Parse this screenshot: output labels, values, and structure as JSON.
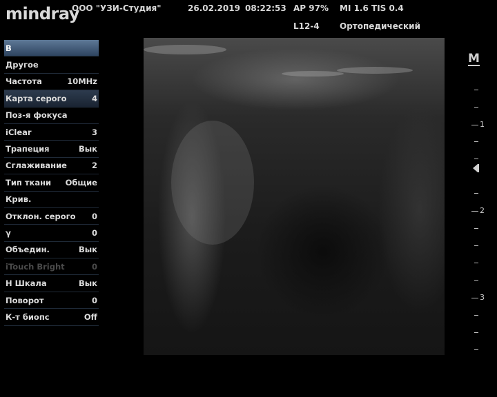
{
  "header": {
    "logo": "mindray",
    "clinic": "ООО \"УЗИ-Студия\"",
    "date": "26.02.2019",
    "time": "08:22:53",
    "ap": "AP  97%",
    "mi_tis": "MI 1.6  TIS 0.4",
    "probe": "L12-4",
    "preset": "Ортопедический"
  },
  "menu": {
    "items": [
      {
        "label": "B",
        "value": ""
      },
      {
        "label": "Другое",
        "value": ""
      },
      {
        "label": "Частота",
        "value": "10MHz"
      },
      {
        "label": "Карта серого",
        "value": "4"
      },
      {
        "label": "Поз-я фокуса",
        "value": ""
      },
      {
        "label": "iClear",
        "value": "3"
      },
      {
        "label": "Трапеция",
        "value": "Вык"
      },
      {
        "label": "Сглаживание",
        "value": "2"
      },
      {
        "label": "Тип ткани",
        "value": "Общие"
      },
      {
        "label": "Крив.",
        "value": ""
      },
      {
        "label": "Отклон. серого",
        "value": "0"
      },
      {
        "label": "γ",
        "value": "0"
      },
      {
        "label": "Объедин.",
        "value": "Вык"
      },
      {
        "label": "iTouch Bright",
        "value": "0"
      },
      {
        "label": "H Шкала",
        "value": "Вык"
      },
      {
        "label": "Поворот",
        "value": "0"
      },
      {
        "label": "К-т биопс",
        "value": "Off"
      }
    ]
  },
  "depth_scale": {
    "marker": "M",
    "labels": [
      "1",
      "2",
      "3"
    ]
  }
}
